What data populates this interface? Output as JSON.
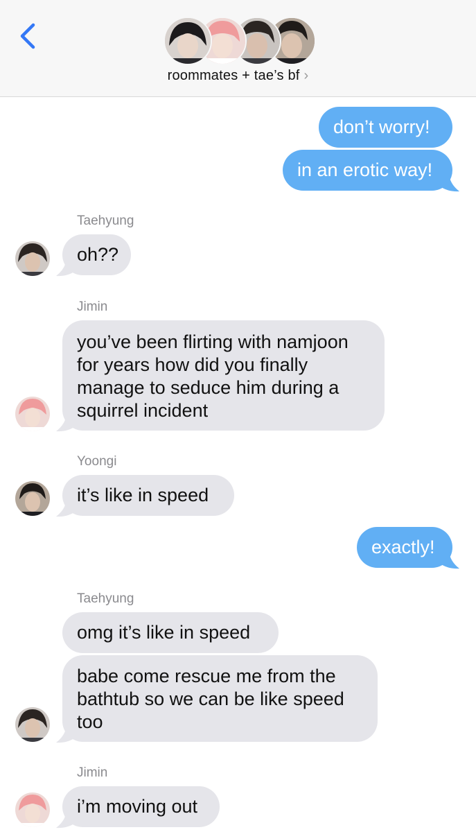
{
  "header": {
    "group_name": "roommates + tae’s bf",
    "chevron": "›",
    "back_icon": "chevron-left-icon",
    "accent_color": "#3478f6"
  },
  "colors": {
    "outgoing_bubble": "#61aff4",
    "incoming_bubble": "#e5e5ea",
    "header_background": "#f7f7f7"
  },
  "messages": [
    {
      "from": "me",
      "text": "don’t worry!"
    },
    {
      "from": "me",
      "text": "in an erotic way!"
    },
    {
      "sender": "Taehyung",
      "text": "oh??"
    },
    {
      "sender": "Jimin",
      "text": "you’ve been flirting with namjoon for years how did you finally manage to seduce him during a squirrel incident"
    },
    {
      "sender": "Yoongi",
      "text": "it’s like in speed"
    },
    {
      "from": "me",
      "text": "exactly!"
    },
    {
      "sender": "Taehyung",
      "text": "omg it’s like in speed"
    },
    {
      "sender": "Taehyung",
      "text": "babe come rescue me from the bathtub so we can be like speed too"
    },
    {
      "sender": "Jimin",
      "text": "i’m moving out"
    }
  ]
}
